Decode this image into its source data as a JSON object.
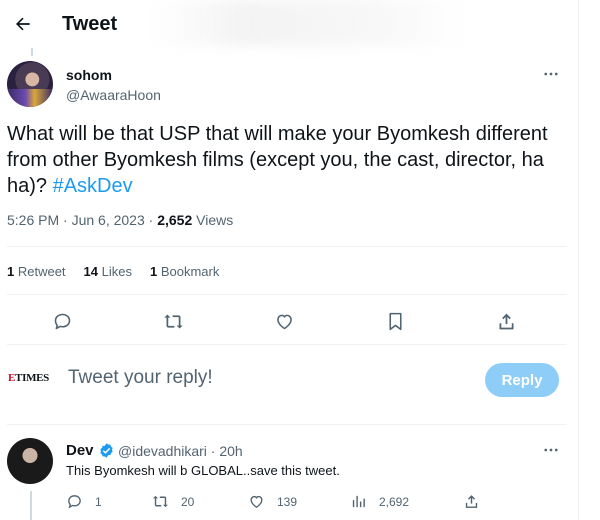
{
  "header": {
    "title": "Tweet"
  },
  "tweet": {
    "author_name": "sohom",
    "author_handle": "@AwaaraHoon",
    "text": "What will be that USP that will make your Byomkesh different from other Byomkesh films (except you, the cast, director, ha ha)? ",
    "hashtag": "#AskDev",
    "time": "5:26 PM · Jun 6, 2023 · ",
    "views_count": "2,652",
    "views_label": " Views",
    "stats": {
      "retweets_count": "1",
      "retweets_label": " Retweet",
      "likes_count": "14",
      "likes_label": " Likes",
      "bookmarks_count": "1",
      "bookmarks_label": " Bookmark"
    }
  },
  "composer": {
    "account_logo_e": "E",
    "account_logo_rest": "TIMES",
    "placeholder": "Tweet your reply!",
    "reply_label": "Reply"
  },
  "reply": {
    "author_name": "Dev",
    "author_handle": "@idevadhikari · 20h",
    "text": "This Byomkesh will b GLOBAL..save this tweet.",
    "replies": "1",
    "retweets": "20",
    "likes": "139",
    "views": "2,692"
  },
  "colors": {
    "accent": "#1d9bf0",
    "reply_button": "#8ecdf7",
    "muted": "#536471",
    "text": "#0f1419"
  },
  "icons": [
    "back-arrow-icon",
    "more-icon",
    "reply-icon",
    "retweet-icon",
    "like-icon",
    "bookmark-icon",
    "share-icon",
    "verified-icon",
    "views-icon"
  ]
}
